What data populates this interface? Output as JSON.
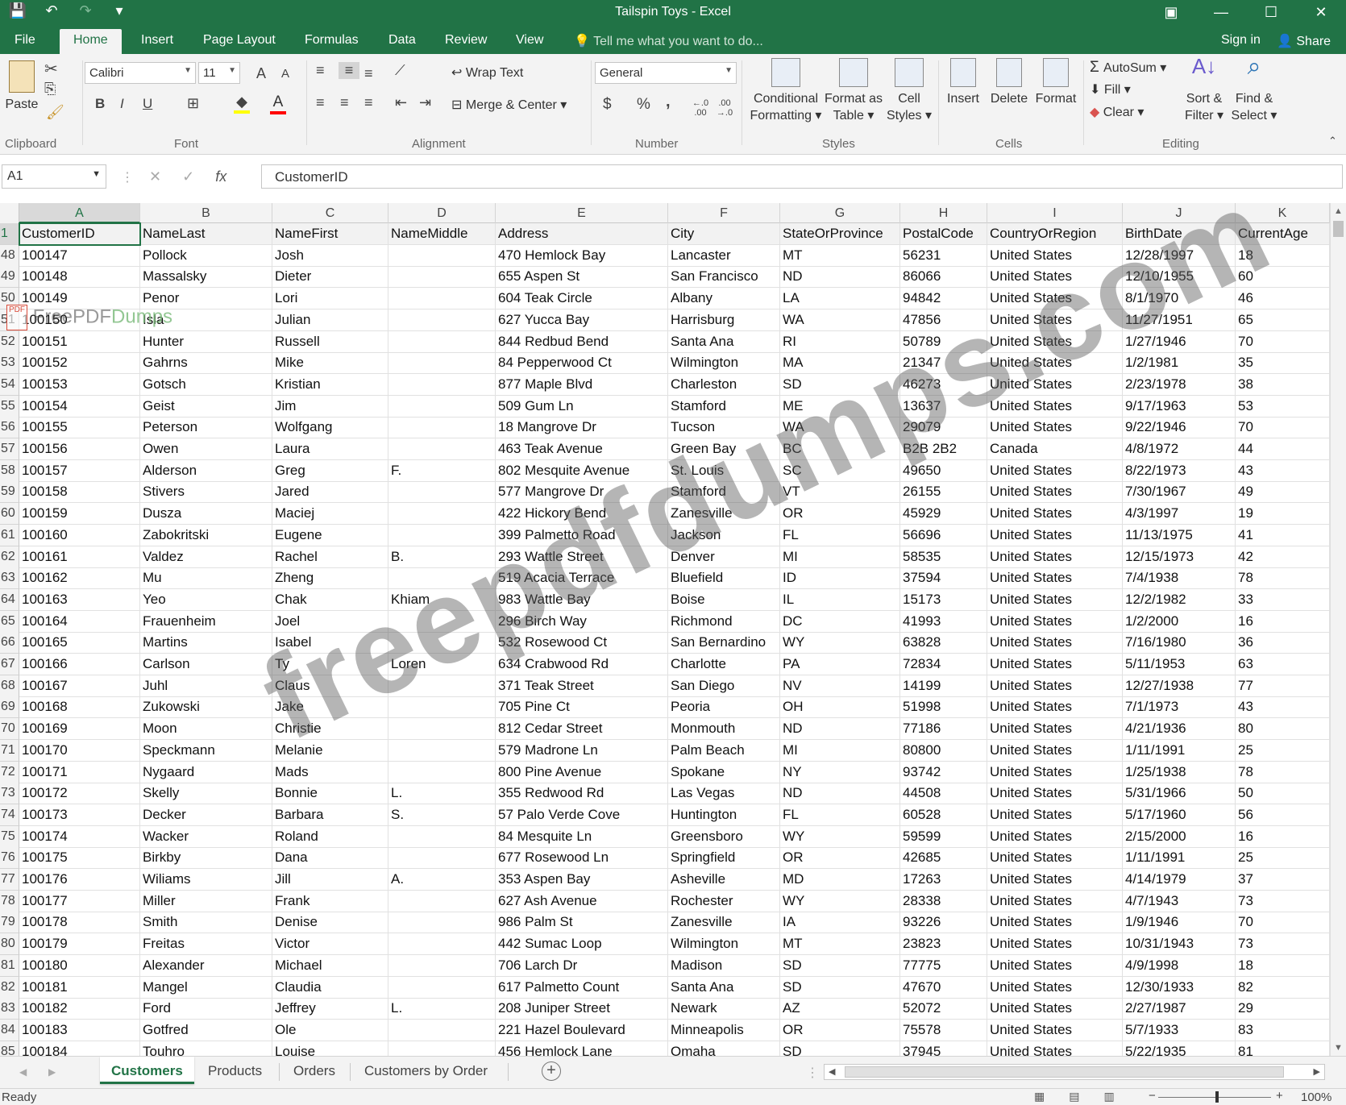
{
  "window": {
    "title": "Tailspin Toys - Excel",
    "minimize": "—",
    "restore": "☐",
    "close": "✕",
    "ribbon_options": "▣"
  },
  "qat": {
    "save": "💾",
    "undo": "↶",
    "redo": "↷",
    "customize": "▾"
  },
  "tabs": [
    "File",
    "Home",
    "Insert",
    "Page Layout",
    "Formulas",
    "Data",
    "Review",
    "View"
  ],
  "active_tab": "Home",
  "tell_me": "Tell me what you want to do...",
  "sign_in": "Sign in",
  "share": "Share",
  "ribbon": {
    "clipboard": {
      "paste": "Paste",
      "label": "Clipboard"
    },
    "font": {
      "name": "Calibri",
      "size": "11",
      "bold": "B",
      "italic": "I",
      "underline": "U",
      "grow": "A",
      "shrink": "A",
      "label": "Font"
    },
    "alignment": {
      "wrap_text": "Wrap Text",
      "merge_center": "Merge & Center",
      "label": "Alignment"
    },
    "number": {
      "format": "General",
      "currency": "$",
      "percent": "%",
      "comma": ",",
      "inc_dec": "←.0 .00",
      "dec_dec": ".00 →.0",
      "label": "Number"
    },
    "styles": {
      "conditional": [
        "Conditional",
        "Formatting ▾"
      ],
      "format_table": [
        "Format as",
        "Table ▾"
      ],
      "cell_styles": [
        "Cell",
        "Styles ▾"
      ],
      "label": "Styles"
    },
    "cells": {
      "insert": "Insert",
      "delete": "Delete",
      "format": "Format",
      "label": "Cells"
    },
    "editing": {
      "autosum": "AutoSum",
      "fill": "Fill",
      "clear": "Clear",
      "sort": [
        "Sort &",
        "Filter ▾"
      ],
      "find": [
        "Find &",
        "Select ▾"
      ],
      "label": "Editing"
    }
  },
  "formula_bar": {
    "name_box": "A1",
    "fx": "fx",
    "content": "CustomerID"
  },
  "columns": [
    "A",
    "B",
    "C",
    "D",
    "E",
    "F",
    "G",
    "H",
    "I",
    "J",
    "K"
  ],
  "header_row": {
    "num": "1",
    "cells": [
      "CustomerID",
      "NameLast",
      "NameFirst",
      "NameMiddle",
      "Address",
      "City",
      "StateOrProvince",
      "PostalCode",
      "CountryOrRegion",
      "BirthDate",
      "CurrentAge"
    ]
  },
  "rows": [
    {
      "num": "48",
      "cells": [
        "100147",
        "Pollock",
        "Josh",
        "",
        "470 Hemlock Bay",
        "Lancaster",
        "MT",
        "56231",
        "United States",
        "12/28/1997",
        "18"
      ]
    },
    {
      "num": "49",
      "cells": [
        "100148",
        "Massalsky",
        "Dieter",
        "",
        "655 Aspen St",
        "San Francisco",
        "ND",
        "86066",
        "United States",
        "12/10/1955",
        "60"
      ]
    },
    {
      "num": "50",
      "cells": [
        "100149",
        "Penor",
        "Lori",
        "",
        "604 Teak Circle",
        "Albany",
        "LA",
        "94842",
        "United States",
        "8/1/1970",
        "46"
      ]
    },
    {
      "num": "51",
      "cells": [
        "100150",
        "Isla",
        "Julian",
        "",
        "627 Yucca Bay",
        "Harrisburg",
        "WA",
        "47856",
        "United States",
        "11/27/1951",
        "65"
      ]
    },
    {
      "num": "52",
      "cells": [
        "100151",
        "Hunter",
        "Russell",
        "",
        "844 Redbud Bend",
        "Santa Ana",
        "RI",
        "50789",
        "United States",
        "1/27/1946",
        "70"
      ]
    },
    {
      "num": "53",
      "cells": [
        "100152",
        "Gahrns",
        "Mike",
        "",
        "84 Pepperwood Ct",
        "Wilmington",
        "MA",
        "21347",
        "United States",
        "1/2/1981",
        "35"
      ]
    },
    {
      "num": "54",
      "cells": [
        "100153",
        "Gotsch",
        "Kristian",
        "",
        "877 Maple Blvd",
        "Charleston",
        "SD",
        "46273",
        "United States",
        "2/23/1978",
        "38"
      ]
    },
    {
      "num": "55",
      "cells": [
        "100154",
        "Geist",
        "Jim",
        "",
        "509 Gum Ln",
        "Stamford",
        "ME",
        "13637",
        "United States",
        "9/17/1963",
        "53"
      ]
    },
    {
      "num": "56",
      "cells": [
        "100155",
        "Peterson",
        "Wolfgang",
        "",
        "18 Mangrove Dr",
        "Tucson",
        "WA",
        "29079",
        "United States",
        "9/22/1946",
        "70"
      ]
    },
    {
      "num": "57",
      "cells": [
        "100156",
        "Owen",
        "Laura",
        "",
        "463 Teak Avenue",
        "Green Bay",
        "BC",
        "B2B 2B2",
        "Canada",
        "4/8/1972",
        "44"
      ]
    },
    {
      "num": "58",
      "cells": [
        "100157",
        "Alderson",
        "Greg",
        "F.",
        "802 Mesquite Avenue",
        "St. Louis",
        "SC",
        "49650",
        "United States",
        "8/22/1973",
        "43"
      ]
    },
    {
      "num": "59",
      "cells": [
        "100158",
        "Stivers",
        "Jared",
        "",
        "577 Mangrove Dr",
        "Stamford",
        "VT",
        "26155",
        "United States",
        "7/30/1967",
        "49"
      ]
    },
    {
      "num": "60",
      "cells": [
        "100159",
        "Dusza",
        "Maciej",
        "",
        "422 Hickory Bend",
        "Zanesville",
        "OR",
        "45929",
        "United States",
        "4/3/1997",
        "19"
      ]
    },
    {
      "num": "61",
      "cells": [
        "100160",
        "Zabokritski",
        "Eugene",
        "",
        "399 Palmetto Road",
        "Jackson",
        "FL",
        "56696",
        "United States",
        "11/13/1975",
        "41"
      ]
    },
    {
      "num": "62",
      "cells": [
        "100161",
        "Valdez",
        "Rachel",
        "B.",
        "293 Wattle Street",
        "Denver",
        "MI",
        "58535",
        "United States",
        "12/15/1973",
        "42"
      ]
    },
    {
      "num": "63",
      "cells": [
        "100162",
        "Mu",
        "Zheng",
        "",
        "519 Acacia Terrace",
        "Bluefield",
        "ID",
        "37594",
        "United States",
        "7/4/1938",
        "78"
      ]
    },
    {
      "num": "64",
      "cells": [
        "100163",
        "Yeo",
        "Chak",
        "Khiam",
        "983 Wattle Bay",
        "Boise",
        "IL",
        "15173",
        "United States",
        "12/2/1982",
        "33"
      ]
    },
    {
      "num": "65",
      "cells": [
        "100164",
        "Frauenheim",
        "Joel",
        "",
        "296 Birch Way",
        "Richmond",
        "DC",
        "41993",
        "United States",
        "1/2/2000",
        "16"
      ]
    },
    {
      "num": "66",
      "cells": [
        "100165",
        "Martins",
        "Isabel",
        "",
        "532 Rosewood Ct",
        "San Bernardino",
        "WY",
        "63828",
        "United States",
        "7/16/1980",
        "36"
      ]
    },
    {
      "num": "67",
      "cells": [
        "100166",
        "Carlson",
        "Ty",
        "Loren",
        "634 Crabwood Rd",
        "Charlotte",
        "PA",
        "72834",
        "United States",
        "5/11/1953",
        "63"
      ]
    },
    {
      "num": "68",
      "cells": [
        "100167",
        "Juhl",
        "Claus",
        "",
        "371 Teak Street",
        "San Diego",
        "NV",
        "14199",
        "United States",
        "12/27/1938",
        "77"
      ]
    },
    {
      "num": "69",
      "cells": [
        "100168",
        "Zukowski",
        "Jake",
        "",
        "705 Pine Ct",
        "Peoria",
        "OH",
        "51998",
        "United States",
        "7/1/1973",
        "43"
      ]
    },
    {
      "num": "70",
      "cells": [
        "100169",
        "Moon",
        "Christie",
        "",
        "812 Cedar Street",
        "Monmouth",
        "ND",
        "77186",
        "United States",
        "4/21/1936",
        "80"
      ]
    },
    {
      "num": "71",
      "cells": [
        "100170",
        "Speckmann",
        "Melanie",
        "",
        "579 Madrone Ln",
        "Palm Beach",
        "MI",
        "80800",
        "United States",
        "1/11/1991",
        "25"
      ]
    },
    {
      "num": "72",
      "cells": [
        "100171",
        "Nygaard",
        "Mads",
        "",
        "800 Pine Avenue",
        "Spokane",
        "NY",
        "93742",
        "United States",
        "1/25/1938",
        "78"
      ]
    },
    {
      "num": "73",
      "cells": [
        "100172",
        "Skelly",
        "Bonnie",
        "L.",
        "355 Redwood Rd",
        "Las Vegas",
        "ND",
        "44508",
        "United States",
        "5/31/1966",
        "50"
      ]
    },
    {
      "num": "74",
      "cells": [
        "100173",
        "Decker",
        "Barbara",
        "S.",
        "57 Palo Verde Cove",
        "Huntington",
        "FL",
        "60528",
        "United States",
        "5/17/1960",
        "56"
      ]
    },
    {
      "num": "75",
      "cells": [
        "100174",
        "Wacker",
        "Roland",
        "",
        "84 Mesquite Ln",
        "Greensboro",
        "WY",
        "59599",
        "United States",
        "2/15/2000",
        "16"
      ]
    },
    {
      "num": "76",
      "cells": [
        "100175",
        "Birkby",
        "Dana",
        "",
        "677 Rosewood Ln",
        "Springfield",
        "OR",
        "42685",
        "United States",
        "1/11/1991",
        "25"
      ]
    },
    {
      "num": "77",
      "cells": [
        "100176",
        "Wiliams",
        "Jill",
        "A.",
        "353 Aspen Bay",
        "Asheville",
        "MD",
        "17263",
        "United States",
        "4/14/1979",
        "37"
      ]
    },
    {
      "num": "78",
      "cells": [
        "100177",
        "Miller",
        "Frank",
        "",
        "627 Ash Avenue",
        "Rochester",
        "WY",
        "28338",
        "United States",
        "4/7/1943",
        "73"
      ]
    },
    {
      "num": "79",
      "cells": [
        "100178",
        "Smith",
        "Denise",
        "",
        "986 Palm St",
        "Zanesville",
        "IA",
        "93226",
        "United States",
        "1/9/1946",
        "70"
      ]
    },
    {
      "num": "80",
      "cells": [
        "100179",
        "Freitas",
        "Victor",
        "",
        "442 Sumac Loop",
        "Wilmington",
        "MT",
        "23823",
        "United States",
        "10/31/1943",
        "73"
      ]
    },
    {
      "num": "81",
      "cells": [
        "100180",
        "Alexander",
        "Michael",
        "",
        "706 Larch Dr",
        "Madison",
        "SD",
        "77775",
        "United States",
        "4/9/1998",
        "18"
      ]
    },
    {
      "num": "82",
      "cells": [
        "100181",
        "Mangel",
        "Claudia",
        "",
        "617 Palmetto Count",
        "Santa Ana",
        "SD",
        "47670",
        "United States",
        "12/30/1933",
        "82"
      ]
    },
    {
      "num": "83",
      "cells": [
        "100182",
        "Ford",
        "Jeffrey",
        "L.",
        "208 Juniper Street",
        "Newark",
        "AZ",
        "52072",
        "United States",
        "2/27/1987",
        "29"
      ]
    },
    {
      "num": "84",
      "cells": [
        "100183",
        "Gotfred",
        "Ole",
        "",
        "221 Hazel Boulevard",
        "Minneapolis",
        "OR",
        "75578",
        "United States",
        "5/7/1933",
        "83"
      ]
    },
    {
      "num": "85",
      "cells": [
        "100184",
        "Touhro",
        "Louise",
        "",
        "456 Hemlock Lane",
        "Omaha",
        "SD",
        "37945",
        "United States",
        "5/22/1935",
        "81"
      ]
    }
  ],
  "sheets": [
    "Customers",
    "Products",
    "Orders",
    "Customers by Order"
  ],
  "active_sheet": "Customers",
  "status": {
    "mode": "Ready",
    "zoom": "100%"
  },
  "watermark": {
    "main": "freepdfdumps.com",
    "badge": "PDF",
    "small_a": "FreePDF",
    "small_b": "Dumps"
  },
  "colors": {
    "excel_green": "#217346",
    "ribbon_bg": "#f3f3f3",
    "grid_line": "#e1e1e1"
  }
}
